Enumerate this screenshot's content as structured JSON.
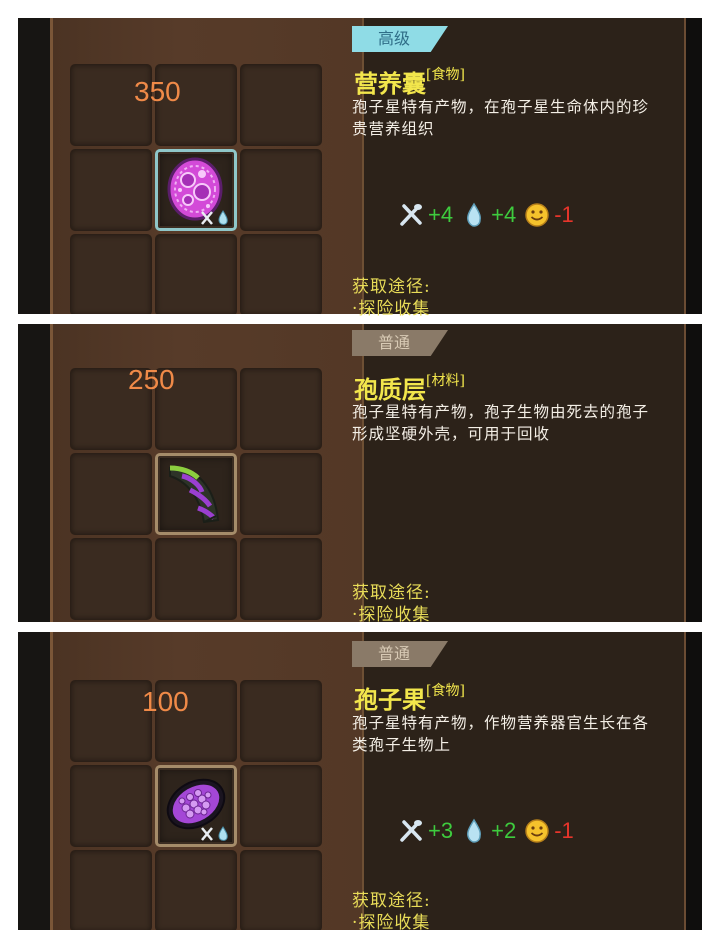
{
  "cards": [
    {
      "price": "350",
      "rarity": "高级",
      "name": "营养囊",
      "category": "[食物]",
      "description": "孢子星特有产物，在孢子星生命体内的珍贵营养组织",
      "stats": [
        {
          "icon": "fork-spoon-icon",
          "value": "+4"
        },
        {
          "icon": "water-drop-icon",
          "value": "+4"
        },
        {
          "icon": "smiley-icon",
          "value": "-1"
        }
      ],
      "source_label": "获取途径:",
      "source": "·探险收集"
    },
    {
      "price": "250",
      "rarity": "普通",
      "name": "孢质层",
      "category": "[材料]",
      "description": "孢子星特有产物，孢子生物由死去的孢子形成坚硬外壳，可用于回收",
      "source_label": "获取途径:",
      "source": "·探险收集"
    },
    {
      "price": "100",
      "rarity": "普通",
      "name": "孢子果",
      "category": "[食物]",
      "description": "孢子星特有产物，作物营养器官生长在各类孢子生物上",
      "stats": [
        {
          "icon": "fork-spoon-icon",
          "value": "+3"
        },
        {
          "icon": "water-drop-icon",
          "value": "+2"
        },
        {
          "icon": "smiley-icon",
          "value": "-1"
        }
      ],
      "source_label": "获取途径:",
      "source": "·探险收集"
    }
  ],
  "colors": {
    "price": "#f08a48",
    "name": "#f2e64c",
    "positive": "#3ecb3e",
    "negative": "#e7352b",
    "rare_badge": "#8fdce6",
    "common_badge": "#8a7a68"
  }
}
